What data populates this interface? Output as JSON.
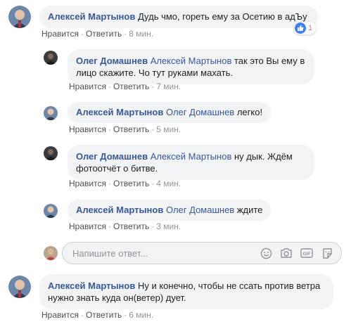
{
  "colors": {
    "link": "#385898",
    "bubble": "#f2f3f5",
    "meta": "#90949c",
    "like_blue": "#4080ff"
  },
  "comments": [
    {
      "author": "Алексей Мартынов",
      "text": " Дудь чмо, гореть ему за Осетию в адЪу",
      "like_label": "Нравится",
      "reply_label": "Ответить",
      "time": "8 мин.",
      "reaction_icon": "like-icon",
      "reaction_count": "1"
    },
    {
      "author": "Олег Домашнев",
      "mention": "Алексей Мартынов",
      "text": " так это Вы ему в лицо скажите. Чо тут руками махать.",
      "like_label": "Нравится",
      "reply_label": "Ответить",
      "time": "7 мин."
    },
    {
      "author": "Алексей Мартынов",
      "mention": "Олег Домашнев",
      "text": " легко!",
      "like_label": "Нравится",
      "reply_label": "Ответить",
      "time": "5 мин."
    },
    {
      "author": "Олег Домашнев",
      "mention": "Алексей Мартынов",
      "text": " ну дык. Ждём фотоотчёт о битве.",
      "like_label": "Нравится",
      "reply_label": "Ответить",
      "time": "4 мин."
    },
    {
      "author": "Алексей Мартынов",
      "mention": "Олег Домашнев",
      "text": " ждите",
      "like_label": "Нравится",
      "reply_label": "Ответить",
      "time": "3 мин."
    },
    {
      "author": "Алексей Мартынов",
      "text": " Ну и конечно, чтобы не ссать против ветра нужно знать куда он(ветер) дует.",
      "like_label": "Нравится",
      "reply_label": "Ответить",
      "time": "6 мин."
    }
  ],
  "reply_box": {
    "placeholder": "Напишите ответ...",
    "tools": [
      "emoji-icon",
      "camera-icon",
      "gif-icon",
      "sticker-icon"
    ],
    "gif_label": "GIF"
  },
  "separator": "·"
}
